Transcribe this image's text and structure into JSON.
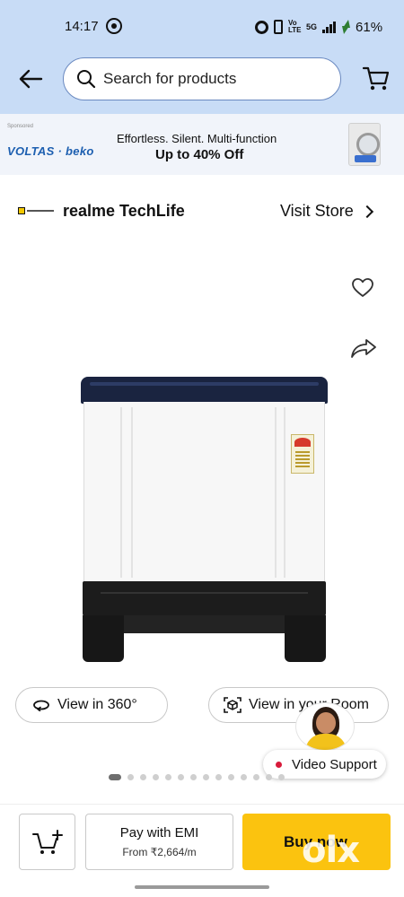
{
  "status_bar": {
    "time": "14:17",
    "network_volte": "Vo LTE",
    "network_type": "5G",
    "battery_percent": "61%"
  },
  "header": {
    "search_placeholder": "Search for products"
  },
  "ad": {
    "sponsored_label": "Sponsored",
    "brand": "VOLTAS · beko",
    "headline": "Effortless. Silent. Multi-function",
    "offer": "Up to 40% Off"
  },
  "store": {
    "name": "realme TechLife",
    "visit_label": "Visit Store"
  },
  "product_media": {
    "view_360_label": "View in 360°",
    "view_room_label": "View in your Room",
    "image_count": 14,
    "active_index": 0
  },
  "support": {
    "video_support_label": "Video Support"
  },
  "bottom_bar": {
    "emi_title": "Pay with EMI",
    "emi_subtitle": "From ₹2,664/m",
    "buy_label": "Buy now",
    "watermark": "olx"
  },
  "colors": {
    "header_bg": "#c8dcf6",
    "buy_button": "#fbc30f",
    "brand_blue": "#1d5fb0"
  }
}
